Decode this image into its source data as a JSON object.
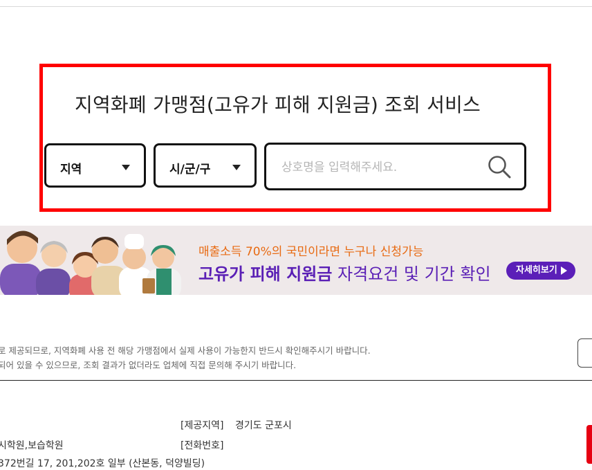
{
  "search": {
    "title": "지역화폐 가맹점(고유가 피해 지원금) 조회 서비스",
    "region_select": "지역",
    "city_select": "시/군/구",
    "placeholder": "상호명을 입력해주세요."
  },
  "banner": {
    "line1": "매출소득 70%의 국민이라면 누구나 신청가능",
    "line2_bold": "고유가 피해 지원금",
    "line2_rest": " 자격요건 및 기간 확인",
    "cta": "자세히보기"
  },
  "notice": {
    "line1": "는으로 제공되므로, 지역화폐 사용 전 해당 가맹점에서 실제 사용이 가능한지 반드시 확인해주시기 바랍니다.",
    "line2": "누락되어 있을 수 있으므로, 조회 결과가 없더라도 업체에 직접 문의해 주시기 바랍니다."
  },
  "result": {
    "region_label": "[제공지역]",
    "region_value": "경기도 군포시",
    "phone_label": "[전화번호]",
    "category_partial": "시학원,보습학원",
    "address_partial": "372번길 17, 201,202호 일부 (산본동, 덕양빌딩)"
  },
  "colors": {
    "highlight": "#ff0000",
    "banner_purple": "#5b1fb8",
    "banner_orange": "#e86a12"
  }
}
